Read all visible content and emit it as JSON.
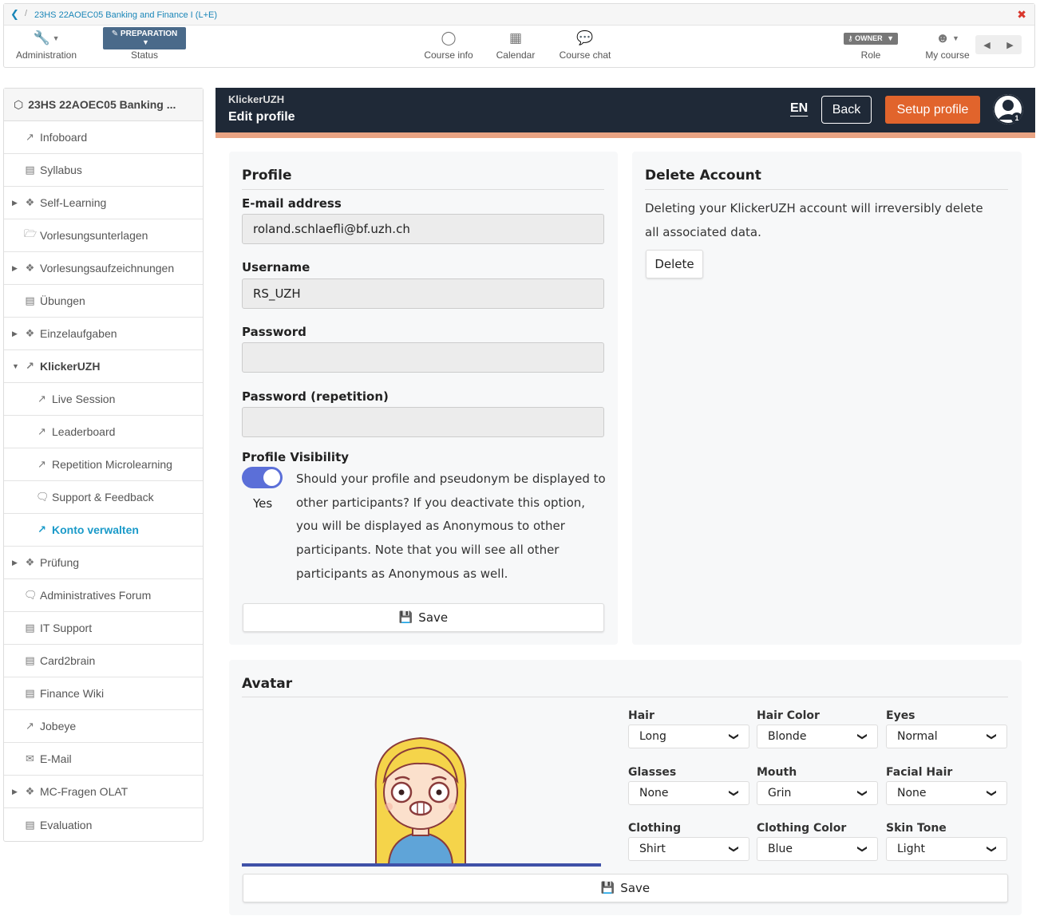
{
  "breadcrumb": {
    "back_icon": "chevron-left-icon",
    "separator": "/",
    "course": "23HS 22AOEC05 Banking and Finance I (L+E)",
    "close": "✖"
  },
  "toolbar": {
    "administration": "Administration",
    "status_badge": "PREPARATION",
    "status": "Status",
    "course_info": "Course info",
    "calendar": "Calendar",
    "course_chat": "Course chat",
    "role_badge": "OWNER",
    "role": "Role",
    "my_course": "My course"
  },
  "sidebar": {
    "course_title": "23HS 22AOEC05 Banking ...",
    "items": [
      {
        "label": "Infoboard"
      },
      {
        "label": "Syllabus"
      },
      {
        "label": "Self-Learning"
      },
      {
        "label": "Vorlesungsunterlagen"
      },
      {
        "label": "Vorlesungsaufzeichnungen"
      },
      {
        "label": "Übungen"
      },
      {
        "label": "Einzelaufgaben"
      },
      {
        "label": "KlickerUZH"
      },
      {
        "label": "Live Session"
      },
      {
        "label": "Leaderboard"
      },
      {
        "label": "Repetition Microlearning"
      },
      {
        "label": "Support & Feedback"
      },
      {
        "label": "Konto verwalten"
      },
      {
        "label": "Prüfung"
      },
      {
        "label": "Administratives Forum"
      },
      {
        "label": "IT Support"
      },
      {
        "label": "Card2brain"
      },
      {
        "label": "Finance Wiki"
      },
      {
        "label": "Jobeye"
      },
      {
        "label": "E-Mail"
      },
      {
        "label": "MC-Fragen OLAT"
      },
      {
        "label": "Evaluation"
      }
    ]
  },
  "klicker": {
    "brand": "KlickerUZH",
    "page_title": "Edit profile",
    "language": "EN",
    "back_label": "Back",
    "setup_label": "Setup profile",
    "avatar_badge": "1",
    "colors": {
      "header": "#1f2937",
      "accent": "#e1642c",
      "stripe": "#e9a383",
      "toggle": "#5b6fd8"
    }
  },
  "profile": {
    "title": "Profile",
    "email_label": "E-mail address",
    "email_value": "roland.schlaefli@bf.uzh.ch",
    "username_label": "Username",
    "username_value": "RS_UZH",
    "password_label": "Password",
    "password_value": "",
    "password_repeat_label": "Password (repetition)",
    "password_repeat_value": "",
    "visibility_label": "Profile Visibility",
    "visibility_toggle": "Yes",
    "visibility_text": "Should your profile and pseudonym be displayed to other participants? If you deactivate this option, you will be displayed as Anonymous to other participants. Note that you will see all other participants as Anonymous as well.",
    "save_label": "Save"
  },
  "delete_account": {
    "title": "Delete Account",
    "text": "Deleting your KlickerUZH account will irreversibly delete all associated data.",
    "button": "Delete"
  },
  "avatar": {
    "title": "Avatar",
    "options": {
      "hair": {
        "label": "Hair",
        "value": "Long"
      },
      "hair_color": {
        "label": "Hair Color",
        "value": "Blonde"
      },
      "eyes": {
        "label": "Eyes",
        "value": "Normal"
      },
      "glasses": {
        "label": "Glasses",
        "value": "None"
      },
      "mouth": {
        "label": "Mouth",
        "value": "Grin"
      },
      "facial_hair": {
        "label": "Facial Hair",
        "value": "None"
      },
      "clothing": {
        "label": "Clothing",
        "value": "Shirt"
      },
      "clothing_color": {
        "label": "Clothing Color",
        "value": "Blue"
      },
      "skin_tone": {
        "label": "Skin Tone",
        "value": "Light"
      }
    },
    "save_label": "Save"
  }
}
